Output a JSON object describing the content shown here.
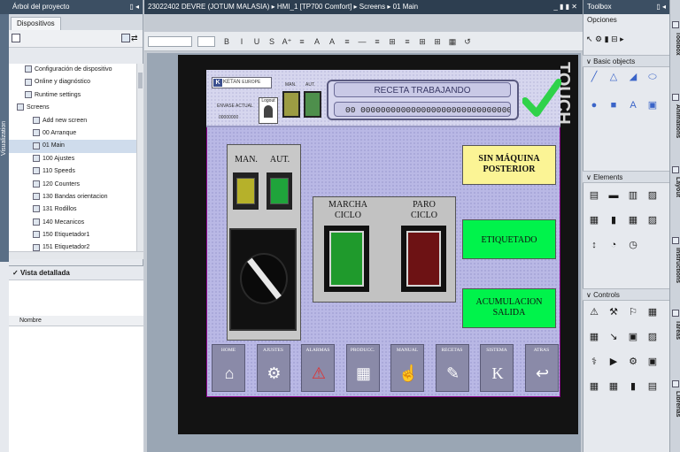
{
  "left_panel": {
    "title": "Árbol del proyecto",
    "vertical_tab": "Visualization",
    "tab_label": "Dispositivos",
    "tree_items": [
      {
        "label": "Configuración de dispositivo",
        "indent": 2
      },
      {
        "label": "Online y diagnóstico",
        "indent": 2
      },
      {
        "label": "Runtime settings",
        "indent": 2
      },
      {
        "label": "Screens",
        "indent": 1
      },
      {
        "label": "Add new screen",
        "indent": 3
      },
      {
        "label": "00 Arranque",
        "indent": 3
      },
      {
        "label": "01 Main",
        "indent": 3,
        "selected": true
      },
      {
        "label": "100 Ajustes",
        "indent": 3
      },
      {
        "label": "110 Speeds",
        "indent": 3
      },
      {
        "label": "120 Counters",
        "indent": 3
      },
      {
        "label": "130 Bandas orientacion",
        "indent": 3
      },
      {
        "label": "131 Rodillos",
        "indent": 3
      },
      {
        "label": "140 Mecanicos",
        "indent": 3
      },
      {
        "label": "150 Etiquetador1",
        "indent": 3
      },
      {
        "label": "151 Etiquetador2",
        "indent": 3
      }
    ],
    "detail_title": "Vista detallada",
    "detail_column": "Nombre"
  },
  "editor": {
    "breadcrumb": "23022402 DEVRE (JOTUM MALASIA)  ▸  HMI_1 [TP700 Comfort]  ▸  Screens  ▸  01 Main",
    "window_controls": "_ ▮ ▮ ✕",
    "toolbar": [
      "B",
      "I",
      "U",
      "S",
      "A⁺",
      "≡",
      "A",
      "A",
      "≡",
      "—",
      "≡",
      "⊞",
      "≡",
      "⊞",
      "⊞",
      "▦",
      "↺"
    ],
    "background_text": "TOUCH"
  },
  "hmi": {
    "logo_text": "KETAN",
    "logo_letter": "K",
    "logo_sub": "EUROPE",
    "order_label": "ENVASE ACTUAL",
    "order_value": "00000000",
    "login_label": "Logout",
    "man_small": "MAN.",
    "aut_small": "AUT.",
    "receta_title": "RECETA TRABAJANDO",
    "receta_value": "00  00000000000000000000000000000000",
    "check_color": "#2fd24a",
    "mode_man": "MAN.",
    "mode_aut": "AUT.",
    "marcha": "MARCHA\nCICLO",
    "paro": "PARO\nCICLO",
    "btn_sin_maquina": "SIN MÁQUINA\nPOSTERIOR",
    "btn_etiquetado": "ETIQUETADO",
    "btn_acumulacion": "ACUMULACION\nSALIDA",
    "nav": [
      {
        "label": "HOME",
        "icon": "home-icon",
        "glyph": "⌂"
      },
      {
        "label": "AJUSTES",
        "icon": "gears-icon",
        "glyph": "⚙"
      },
      {
        "label": "ALARMAS",
        "icon": "alarm-icon",
        "glyph": "⚠"
      },
      {
        "label": "PRODUCC.",
        "icon": "counter-icon",
        "glyph": "▦"
      },
      {
        "label": "MANUAL",
        "icon": "hand-icon",
        "glyph": "☝"
      },
      {
        "label": "RECETAS",
        "icon": "recipe-icon",
        "glyph": "✎"
      },
      {
        "label": "SISTEMA",
        "icon": "system-logo-icon",
        "glyph": "K"
      },
      {
        "label": "ATRAS",
        "icon": "back-arrow-icon",
        "glyph": "↩"
      }
    ],
    "colors": {
      "panel": "#b9b8e5",
      "yellow": "#fbf495",
      "green": "#00f34b",
      "lamp_man": "#b6b12a",
      "lamp_aut": "#1fa43b",
      "marcha": "#1f9a2c",
      "paro": "#6d1214"
    }
  },
  "right_panel": {
    "title": "Toolbox",
    "opciones": "Opciones",
    "sec_basic": "Basic objects",
    "sec_elements": "Elements",
    "sec_controls": "Controls",
    "tabs": [
      "Toolbox",
      "Animations",
      "Layout",
      "Instructions",
      "Tareas",
      "Librerías"
    ]
  }
}
